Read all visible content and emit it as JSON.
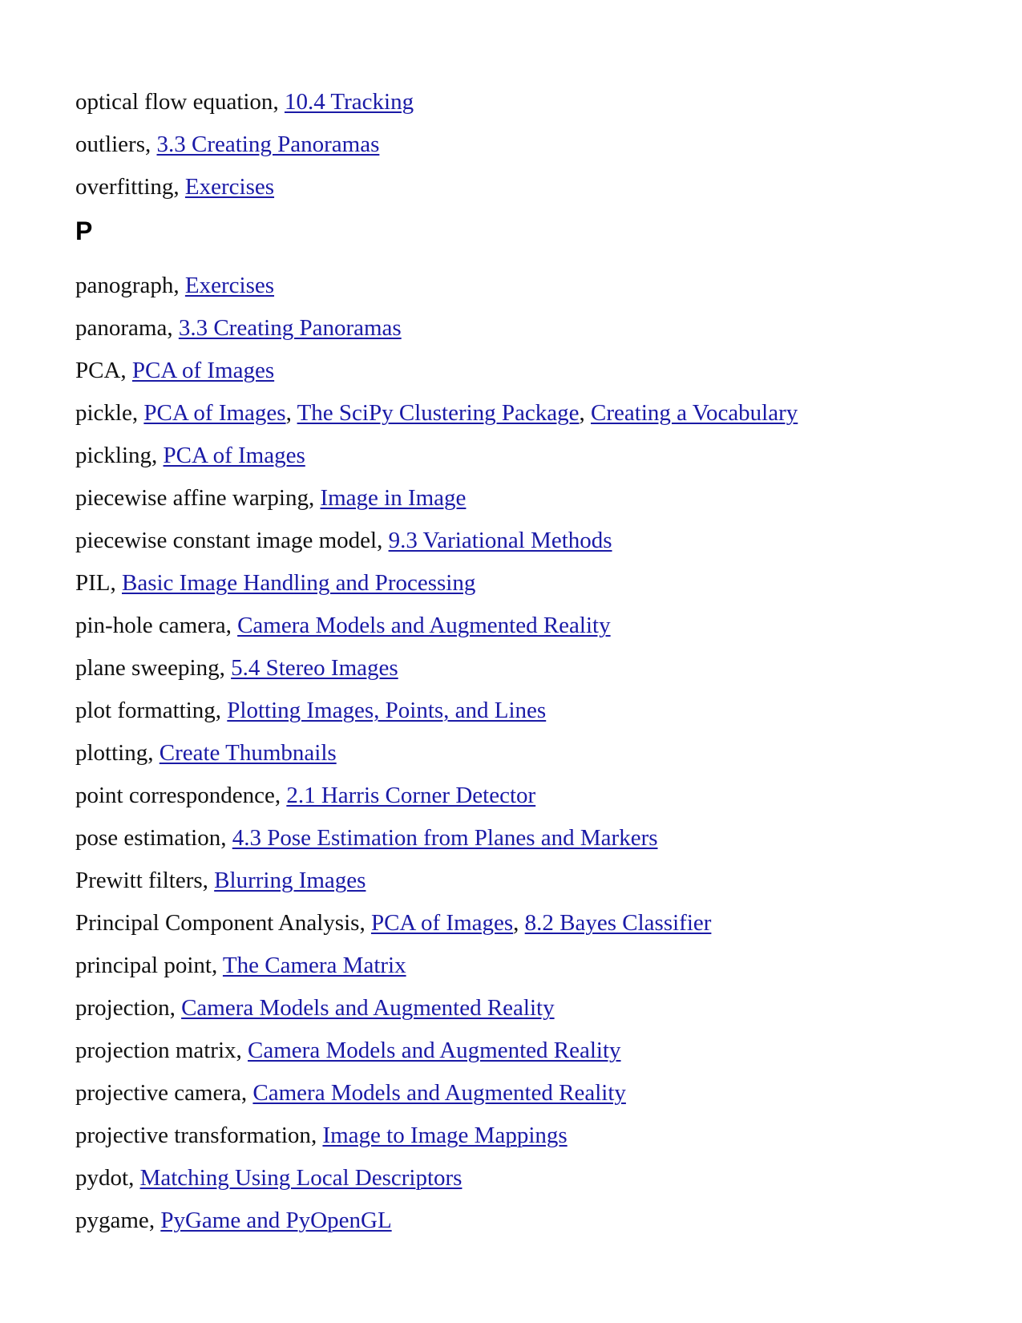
{
  "section_before": [
    {
      "term": "optical flow equation",
      "links": [
        "10.4 Tracking"
      ]
    },
    {
      "term": "outliers",
      "links": [
        "3.3 Creating Panoramas"
      ]
    },
    {
      "term": "overfitting",
      "links": [
        "Exercises"
      ]
    }
  ],
  "heading": "P",
  "section_p": [
    {
      "term": "panograph",
      "links": [
        "Exercises"
      ]
    },
    {
      "term": "panorama",
      "links": [
        "3.3 Creating Panoramas"
      ]
    },
    {
      "term": "PCA",
      "links": [
        "PCA of Images"
      ]
    },
    {
      "term": "pickle",
      "links": [
        "PCA of Images",
        "The SciPy Clustering Package",
        "Creating a Vocabulary"
      ]
    },
    {
      "term": "pickling",
      "links": [
        "PCA of Images"
      ]
    },
    {
      "term": "piecewise affine warping",
      "links": [
        "Image in Image"
      ]
    },
    {
      "term": "piecewise constant image model",
      "links": [
        "9.3 Variational Methods"
      ]
    },
    {
      "term": "PIL",
      "links": [
        "Basic Image Handling and Processing"
      ]
    },
    {
      "term": "pin-hole camera",
      "links": [
        "Camera Models and Augmented Reality"
      ]
    },
    {
      "term": "plane sweeping",
      "links": [
        "5.4 Stereo Images"
      ]
    },
    {
      "term": "plot formatting",
      "links": [
        "Plotting Images, Points, and Lines"
      ]
    },
    {
      "term": "plotting",
      "links": [
        "Create Thumbnails"
      ]
    },
    {
      "term": "point correspondence",
      "links": [
        "2.1 Harris Corner Detector"
      ]
    },
    {
      "term": "pose estimation",
      "links": [
        "4.3 Pose Estimation from Planes and Markers"
      ]
    },
    {
      "term": "Prewitt filters",
      "links": [
        "Blurring Images"
      ]
    },
    {
      "term": "Principal Component Analysis",
      "links": [
        "PCA of Images",
        "8.2 Bayes Classifier"
      ]
    },
    {
      "term": "principal point",
      "links": [
        "The Camera Matrix"
      ]
    },
    {
      "term": "projection",
      "links": [
        "Camera Models and Augmented Reality"
      ]
    },
    {
      "term": "projection matrix",
      "links": [
        "Camera Models and Augmented Reality"
      ]
    },
    {
      "term": "projective camera",
      "links": [
        "Camera Models and Augmented Reality"
      ]
    },
    {
      "term": "projective transformation",
      "links": [
        "Image to Image Mappings"
      ]
    },
    {
      "term": "pydot",
      "links": [
        "Matching Using Local Descriptors"
      ]
    },
    {
      "term": "pygame",
      "links": [
        "PyGame and PyOpenGL"
      ]
    }
  ],
  "colors": {
    "text": "#111111",
    "link": "#1a1aa6",
    "background": "#ffffff"
  }
}
